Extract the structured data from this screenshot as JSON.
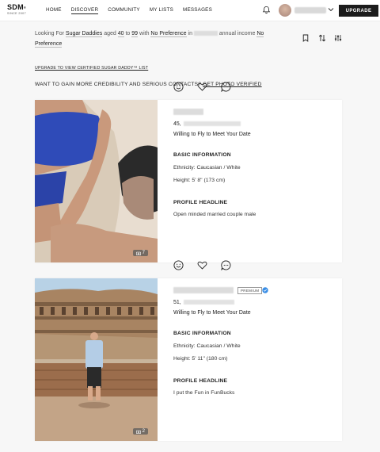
{
  "brand": {
    "logo": "SDM",
    "logo_mark": "®",
    "since": "SINCE 2007"
  },
  "nav": {
    "items": [
      "HOME",
      "DISCOVER",
      "COMMUNITY",
      "MY LISTS",
      "MESSAGES"
    ],
    "active": "DISCOVER"
  },
  "header": {
    "upgrade_label": "UPGRADE"
  },
  "filters": {
    "looking_for_label": "Looking For",
    "looking_for": "Sugar Daddies",
    "aged_label": "aged",
    "age_min": "40",
    "to_label": "to",
    "age_max": "99",
    "with_label": "with",
    "with_value": "No Preference",
    "in_label": "in",
    "annual_income_label": "annual income",
    "income_value": "No Preference"
  },
  "promo": {
    "upgrade_link": "UPGRADE TO VIEW CERTIFIED SUGAR DADDY™ LIST",
    "verify_text": "WANT TO GAIN MORE CREDIBILITY AND SERIOUS CONTACTS?",
    "verify_link": "GET PHOTO VERIFIED"
  },
  "profiles": [
    {
      "age": "45,",
      "tagline": "Willing to Fly to Meet Your Date",
      "basic_heading": "BASIC INFORMATION",
      "ethnicity": "Ethnicity: Caucasian / White",
      "height": "Height: 5' 8\" (173 cm)",
      "headline_heading": "PROFILE HEADLINE",
      "headline": "Open minded married couple male",
      "photo_count": "7",
      "premium": false,
      "verified": false
    },
    {
      "age": "51,",
      "tagline": "Willing to Fly to Meet Your Date",
      "basic_heading": "BASIC INFORMATION",
      "ethnicity": "Ethnicity: Caucasian / White",
      "height": "Height: 5' 11\" (180 cm)",
      "headline_heading": "PROFILE HEADLINE",
      "headline": "I put the Fun in FunBucks",
      "photo_count": "2",
      "premium_badge": "PREMIUM",
      "premium": true,
      "verified": true
    }
  ],
  "colors": {
    "verified": "#3a8ee6",
    "button": "#1c1c1c"
  }
}
